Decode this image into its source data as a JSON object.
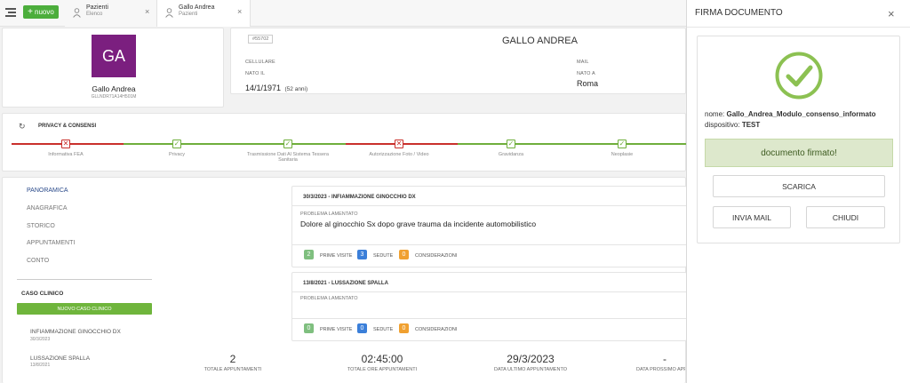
{
  "topbar": {
    "nuovo_label": "nuovo",
    "tabs": [
      {
        "title": "Pazienti",
        "subtitle": "Elenco",
        "close": "×"
      },
      {
        "title": "Gallo Andrea",
        "subtitle": "Pazienti",
        "close": "×"
      }
    ]
  },
  "patient": {
    "initials": "GA",
    "avatar_color": "#7b1f7f",
    "name": "Gallo Andrea",
    "code": "GLLNDR71A14H501M",
    "id_badge": "#55702",
    "full_name": "GALLO ANDREA",
    "cellulare_label": "CELLULARE",
    "cellulare_value": "",
    "mail_label": "MAIL",
    "nato_il_label": "NATO IL",
    "nato_il_value": "14/1/1971",
    "age": "(52 anni)",
    "nato_a_label": "NATO A",
    "nato_a_value": "Roma"
  },
  "privacy": {
    "title": "PRIVACY & CONSENSI",
    "steps": [
      {
        "label": "Informativa FEA",
        "status": "ko"
      },
      {
        "label": "Privacy",
        "status": "ok"
      },
      {
        "label": "Trasmissione Dati Al Sistema Tessera Sanitaria",
        "status": "ok"
      },
      {
        "label": "Autorizzazione Foto / Video",
        "status": "ko"
      },
      {
        "label": "Gravidanza",
        "status": "ok"
      },
      {
        "label": "Neoplasie",
        "status": "ok"
      }
    ]
  },
  "nav": {
    "items": [
      "PANORAMICA",
      "ANAGRAFICA",
      "STORICO",
      "APPUNTAMENTI",
      "CONTO"
    ],
    "caso_clinico_title": "CASO CLINICO",
    "nuovo_caso_label": "NUOVO CASO CLINICO",
    "cases": [
      {
        "name": "INFIAMMAZIONE GINOCCHIO DX",
        "date": "30/3/2023"
      },
      {
        "name": "LUSSAZIONE SPALLA",
        "date": "13/8/2021"
      }
    ]
  },
  "cases": [
    {
      "title": "30/3/2023 - INFIAMMAZIONE GINOCCHIO DX",
      "problem_label": "PROBLEMA LAMENTATO",
      "problem": "Dolore al ginocchio Sx dopo grave trauma da incidente automobilistico",
      "counts": [
        {
          "value": "2",
          "label": "PRIME VISITE",
          "color": "#7fbf7f"
        },
        {
          "value": "3",
          "label": "SEDUTE",
          "color": "#3b7fd9"
        },
        {
          "value": "0",
          "label": "CONSIDERAZIONI",
          "color": "#f0a030"
        }
      ]
    },
    {
      "title": "13/8/2021 - LUSSAZIONE SPALLA",
      "problem_label": "PROBLEMA LAMENTATO",
      "problem": "",
      "counts": [
        {
          "value": "0",
          "label": "PRIME VISITE",
          "color": "#7fbf7f"
        },
        {
          "value": "0",
          "label": "SEDUTE",
          "color": "#3b7fd9"
        },
        {
          "value": "0",
          "label": "CONSIDERAZIONI",
          "color": "#f0a030"
        }
      ]
    }
  ],
  "stats": [
    {
      "value": "2",
      "label": "TOTALE APPUNTAMENTI"
    },
    {
      "value": "02:45:00",
      "label": "TOTALE ORE APPUNTAMENTI"
    },
    {
      "value": "29/3/2023",
      "label": "DATA ULTIMO APPUNTAMENTO"
    },
    {
      "value": "-",
      "label": "DATA PROSSIMO APP"
    }
  ],
  "panel": {
    "title": "FIRMA DOCUMENTO",
    "close": "×",
    "nome_label": "nome:",
    "nome_value": "Gallo_Andrea_Modulo_consenso_informato",
    "dispositivo_label": "dispositivo:",
    "dispositivo_value": "TEST",
    "status_text": "documento firmato!",
    "scarica_label": "SCARICA",
    "invia_mail_label": "INVIA MAIL",
    "chiudi_label": "CHIUDI",
    "accent": "#8cc152"
  }
}
